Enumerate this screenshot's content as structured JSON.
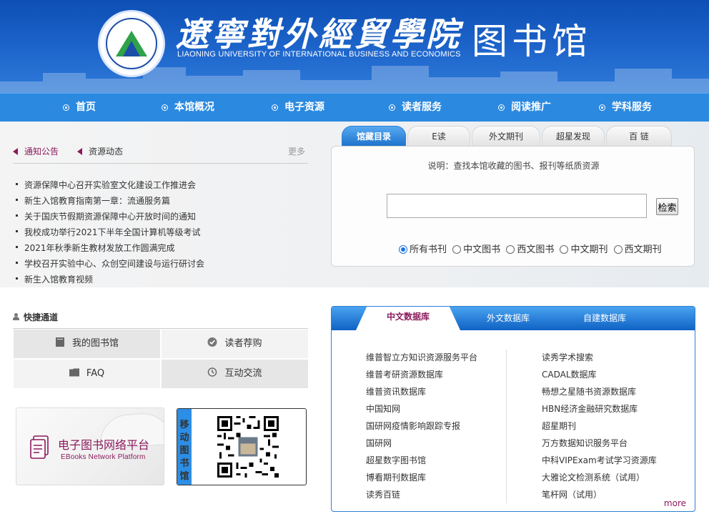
{
  "header": {
    "school_name": "遼寧對外經貿學院",
    "school_name_en": "LIAONING UNIVERSITY OF INTERNATIONAL BUSINESS AND ECONOMICS",
    "library_name": "图书馆"
  },
  "nav": {
    "items": [
      {
        "label": "首页"
      },
      {
        "label": "本馆概况"
      },
      {
        "label": "电子资源"
      },
      {
        "label": "读者服务"
      },
      {
        "label": "阅读推广"
      },
      {
        "label": "学科服务"
      }
    ]
  },
  "notice": {
    "tabs": [
      {
        "label": "通知公告"
      },
      {
        "label": "资源动态"
      }
    ],
    "more_label": "更多",
    "items": [
      "资源保障中心召开实验室文化建设工作推进会",
      "新生入馆教育指南第一章：流通服务篇",
      "关于国庆节假期资源保障中心开放时间的通知",
      "我校成功举行2021下半年全国计算机等级考试",
      "2021年秋季新生教材发放工作圆满完成",
      "学校召开实验中心、众创空间建设与运行研讨会",
      "新生入馆教育视频"
    ]
  },
  "search": {
    "tabs": [
      {
        "label": "馆藏目录"
      },
      {
        "label": "E读"
      },
      {
        "label": "外文期刊"
      },
      {
        "label": "超星发现"
      },
      {
        "label": "百 链"
      }
    ],
    "description": "说明：查找本馆收藏的图书、报刊等纸质资源",
    "input_value": "",
    "button_label": "检索",
    "options": [
      {
        "label": "所有书刊",
        "checked": true
      },
      {
        "label": "中文图书",
        "checked": false
      },
      {
        "label": "西文图书",
        "checked": false
      },
      {
        "label": "中文期刊",
        "checked": false
      },
      {
        "label": "西文期刊",
        "checked": false
      }
    ]
  },
  "quick": {
    "title": "快捷通道",
    "buttons": [
      {
        "label": "我的图书馆"
      },
      {
        "label": "读者荐购"
      },
      {
        "label": "FAQ"
      },
      {
        "label": "互动交流"
      }
    ]
  },
  "ebook": {
    "title": "电子图书网络平台",
    "subtitle": "EBooks Network Platform"
  },
  "mobile": {
    "label_chars": [
      "移",
      "动",
      "图",
      "书",
      "馆"
    ]
  },
  "databases": {
    "tabs": [
      {
        "label": "中文数据库"
      },
      {
        "label": "外文数据库"
      },
      {
        "label": "自建数据库"
      }
    ],
    "left": [
      "维普智立方知识资源服务平台",
      "维普考研资源数据库",
      "维普资讯数据库",
      "中国知网",
      "国研网疫情影响跟踪专报",
      "国研网",
      "超星数字图书馆",
      "博看期刊数据库",
      "读秀百链"
    ],
    "right": [
      "读秀学术搜索",
      "CADAL数据库",
      "畅想之星随书资源数据库",
      "HBN经济金融研究数据库",
      "超星期刊",
      "万方数据知识服务平台",
      "中科VIPExam考试学习资源库",
      "大雅论文检测系统（试用）",
      "笔杆网（试用）"
    ],
    "more_label": "more"
  },
  "colors": {
    "header_blue": "#0d4fb5",
    "nav_blue": "#2b89e0",
    "accent_purple": "#8b1a5c"
  }
}
